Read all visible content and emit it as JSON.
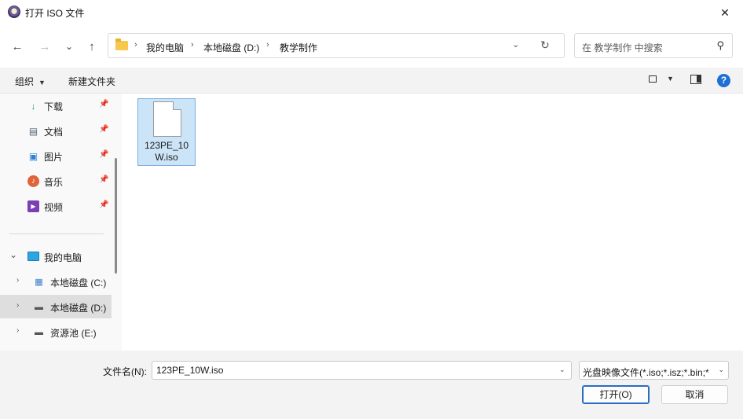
{
  "window": {
    "title": "打开 ISO 文件",
    "close_glyph": "✕"
  },
  "nav": {
    "back_glyph": "←",
    "forward_glyph": "→",
    "recent_glyph": "⌄",
    "up_glyph": "↑",
    "breadcrumb": [
      "我的电脑",
      "本地磁盘 (D:)",
      "教学制作"
    ],
    "separator": "›",
    "dropdown_glyph": "⌄",
    "refresh_glyph": "↻",
    "search_placeholder": "在 教学制作 中搜索",
    "search_glyph": "⚲"
  },
  "toolbar": {
    "organize_label": "组织",
    "organize_caret": "▼",
    "new_folder_label": "新建文件夹",
    "view_caret": "▼",
    "help_label": "?"
  },
  "sidebar": {
    "quick_access": [
      {
        "label": "下载",
        "icon": "download-icon",
        "glyph": "↓",
        "color": "#2a9d5c",
        "pin": "📌"
      },
      {
        "label": "文档",
        "icon": "document-icon",
        "glyph": "▤",
        "color": "#5a6b7c",
        "pin": "📌"
      },
      {
        "label": "图片",
        "icon": "pictures-icon",
        "glyph": "▣",
        "color": "#2f7fd4",
        "pin": "📌"
      },
      {
        "label": "音乐",
        "icon": "music-icon",
        "glyph": "♪",
        "color": "#e0643a",
        "pin": "📌"
      },
      {
        "label": "视频",
        "icon": "video-icon",
        "glyph": "▶",
        "color": "#7a3fb5",
        "pin": "📌"
      }
    ],
    "this_pc": {
      "label": "我的电脑",
      "chevron": "⌄"
    },
    "drives": [
      {
        "label": "本地磁盘 (C:)",
        "chevron": "›",
        "glyph": "▦",
        "selected": false
      },
      {
        "label": "本地磁盘 (D:)",
        "chevron": "›",
        "glyph": "▬",
        "selected": true
      },
      {
        "label": "资源池 (E:)",
        "chevron": "›",
        "glyph": "▬",
        "selected": false
      }
    ]
  },
  "files": [
    {
      "name": "123PE_10W.iso",
      "selected": true
    }
  ],
  "footer": {
    "filename_label": "文件名(N):",
    "filename_value": "123PE_10W.iso",
    "filename_caret": "⌄",
    "filetype_value": "光盘映像文件(*.iso;*.isz;*.bin;*",
    "filetype_caret": "⌄",
    "open_label": "打开(O)",
    "cancel_label": "取消"
  }
}
